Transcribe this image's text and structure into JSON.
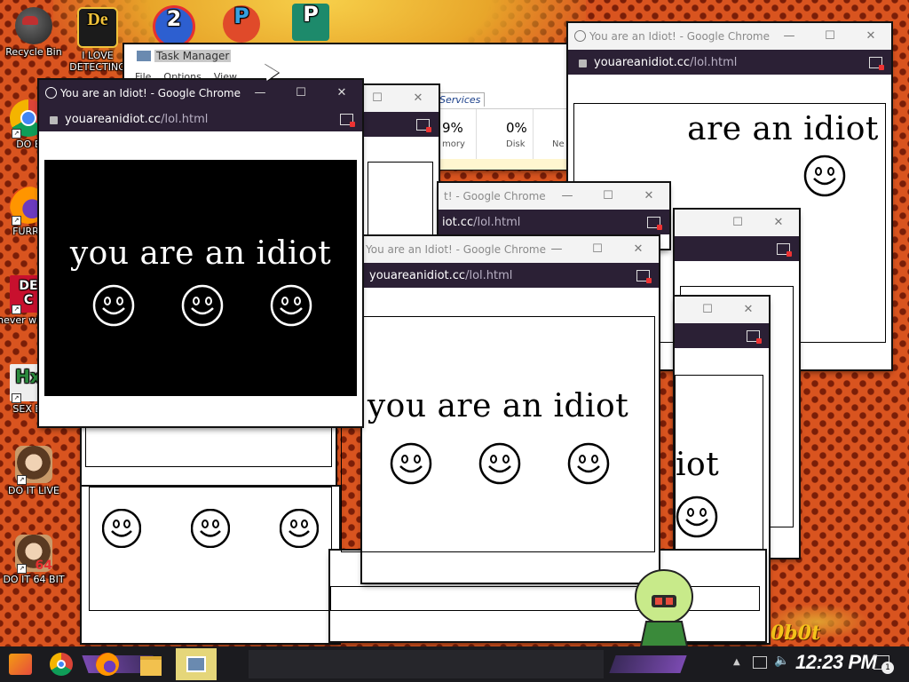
{
  "desktop": {
    "icons": [
      {
        "label": "Recycle Bin",
        "icon": "recycle-bin-icon"
      },
      {
        "label": "I LOVE DETECTING",
        "icon": "detective-app-icon"
      },
      {
        "label": "DO E",
        "icon": "chrome-icon"
      },
      {
        "label": "FURRY",
        "icon": "firefox-icon"
      },
      {
        "label": "never why is",
        "icon": "dec-icon"
      },
      {
        "label": "SEX EI",
        "icon": "hx-icon"
      },
      {
        "label": "DO IT LIVE",
        "icon": "portrait-icon"
      },
      {
        "label": "DO IT 64 BIT",
        "icon": "portrait-64-icon"
      }
    ],
    "corner_text": "0b0t"
  },
  "task_manager": {
    "title": "Task Manager",
    "menu": [
      "File",
      "Options",
      "View"
    ],
    "tab_services": "Services",
    "memory_value": "9%",
    "memory_label": "mory",
    "disk_value": "0%",
    "disk_label": "Disk",
    "net_label": "Ne"
  },
  "popup": {
    "window_title": "You are an Idiot! - Google Chrome",
    "title_partial_1": "t! - Google Chrome",
    "title_partial_2": "You are an Idiot! - Google Chrome",
    "host": "youareanidiot.cc",
    "path": "/lol.html",
    "phrase": "you are an idiot",
    "phrase_partial_1": "are an idiot",
    "phrase_partial_2": "iot",
    "host_partial": "iot.cc",
    "minimize": "—",
    "maximize": "☐",
    "close": "✕"
  },
  "taskbar": {
    "clock": "12:23 PM",
    "notification_count": "1",
    "pinned": [
      "start-button",
      "chrome-icon",
      "firefox-icon",
      "file-explorer-icon",
      "task-manager-icon"
    ]
  }
}
